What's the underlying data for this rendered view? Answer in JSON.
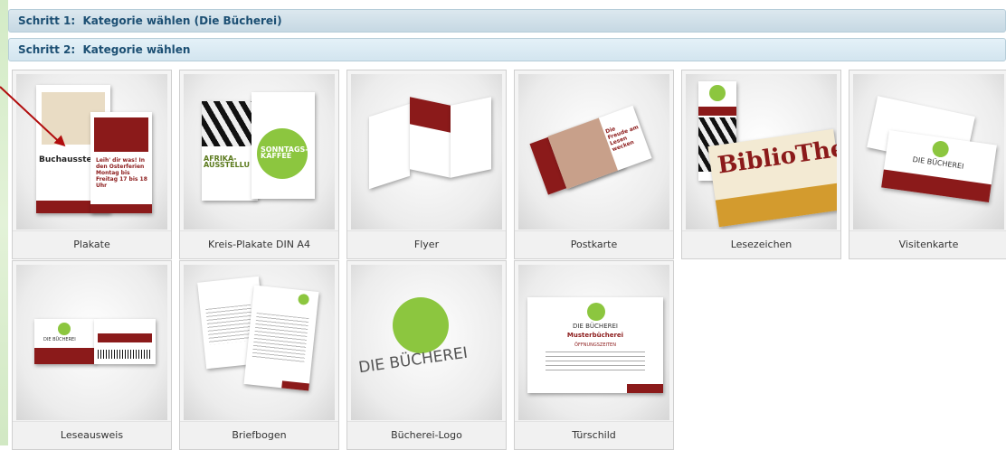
{
  "steps": [
    {
      "label": "Schritt 1:  Kategorie wählen (Die Bücherei)"
    },
    {
      "label": "Schritt 2:  Kategorie wählen"
    }
  ],
  "tiles": [
    {
      "label": "Plakate",
      "thumb_text": "Buchausste",
      "thumb_text2": "Leih' dir was! In den Osterferien Montag bis Freitag 17 bis 18 Uhr"
    },
    {
      "label": "Kreis-Plakate DIN A4",
      "thumb_text": "AFRIKA-AUSSTELLU",
      "thumb_text2": "SONNTAGS-KAFFEE"
    },
    {
      "label": "Flyer"
    },
    {
      "label": "Postkarte",
      "thumb_text": "Die Freude am Lesen wecken"
    },
    {
      "label": "Lesezeichen",
      "thumb_text": "BiblioThek"
    },
    {
      "label": "Visitenkarte",
      "thumb_text": "DIE BÜCHEREI"
    },
    {
      "label": "Leseausweis",
      "thumb_text": "DIE BÜCHEREI"
    },
    {
      "label": "Briefbogen"
    },
    {
      "label": "Bücherei-Logo",
      "thumb_text": "DIE BÜCHEREI"
    },
    {
      "label": "Türschild",
      "thumb_text": "DIE BÜCHEREI",
      "thumb_text2": "Musterbücherei",
      "thumb_text3": "ÖFFNUNGSZEITEN"
    }
  ],
  "colors": {
    "accent": "#8b1a1a",
    "logo_green": "#8cc63f",
    "step_text": "#1c4f73"
  }
}
